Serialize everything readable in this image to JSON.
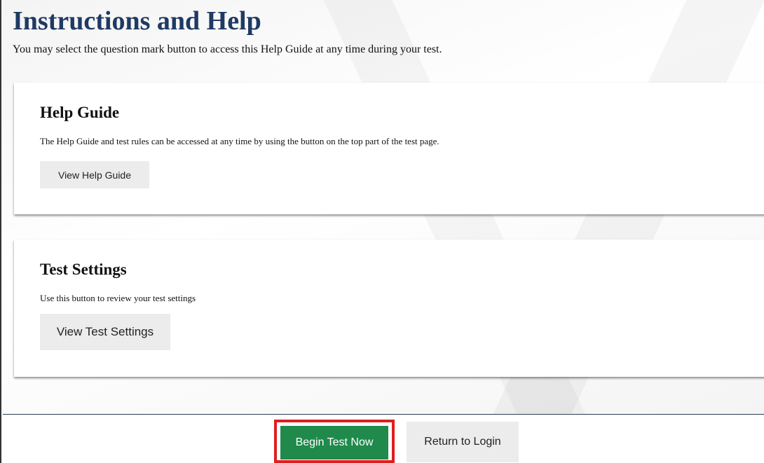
{
  "header": {
    "title": "Instructions and Help",
    "intro": "You may select the question mark button to access this Help Guide at any time during your test."
  },
  "help_card": {
    "heading": "Help Guide",
    "description": "The Help Guide and test rules can be accessed at any time by using the button on the top part of the test page.",
    "button_label": "View Help Guide"
  },
  "settings_card": {
    "heading": "Test Settings",
    "description": "Use this button to review your test settings",
    "button_label": "View Test Settings"
  },
  "footer": {
    "begin_label": "Begin Test Now",
    "return_label": "Return to Login"
  },
  "colors": {
    "title": "#1f3a63",
    "begin_button": "#1f8a4c",
    "highlight_border": "#e01e1e",
    "grey_button": "#ececec"
  }
}
